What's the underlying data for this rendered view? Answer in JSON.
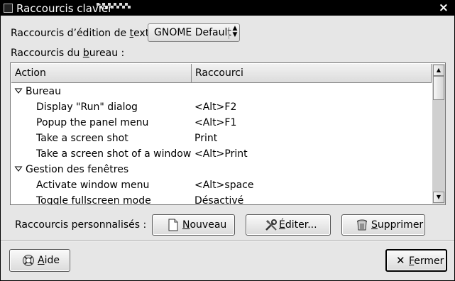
{
  "window": {
    "title": "Raccourcis clavier"
  },
  "editing_shortcuts": {
    "label_pre": "Raccourcis d’édition de ",
    "label_mnemonic": "t",
    "label_post": "exte :",
    "selected": "GNOME Default"
  },
  "desktop_shortcuts": {
    "label_pre": "Raccourcis du ",
    "label_mnemonic": "b",
    "label_post": "ureau :"
  },
  "tree": {
    "columns": [
      "Action",
      "Raccourci"
    ],
    "rows": [
      {
        "type": "group",
        "action": "Bureau",
        "shortcut": ""
      },
      {
        "type": "item",
        "action": "Display \"Run\" dialog",
        "shortcut": "<Alt>F2"
      },
      {
        "type": "item",
        "action": "Popup the panel menu",
        "shortcut": "<Alt>F1"
      },
      {
        "type": "item",
        "action": "Take a screen shot",
        "shortcut": "Print"
      },
      {
        "type": "item",
        "action": "Take a screen shot of a window",
        "shortcut": "<Alt>Print"
      },
      {
        "type": "group",
        "action": "Gestion des fenêtres",
        "shortcut": ""
      },
      {
        "type": "item",
        "action": "Activate window menu",
        "shortcut": "<Alt>space"
      },
      {
        "type": "item",
        "action": "Toggle fullscreen mode",
        "shortcut": "Désactivé"
      }
    ]
  },
  "custom_shortcuts": {
    "label": "Raccourcis personnalisés :",
    "new_mnemonic": "N",
    "new_rest": "ouveau",
    "edit_mnemonic": "É",
    "edit_rest": "diter...",
    "delete_mnemonic": "S",
    "delete_rest": "upprimer"
  },
  "footer": {
    "help_mnemonic": "A",
    "help_rest": "ide",
    "close_mnemonic": "F",
    "close_rest": "ermer"
  },
  "icons": {
    "new": "document-new-icon",
    "edit": "tools-icon",
    "delete": "trash-icon",
    "help": "help-lifebuoy-icon",
    "close": "close-x-icon",
    "expander": "triangle-down-icon"
  }
}
